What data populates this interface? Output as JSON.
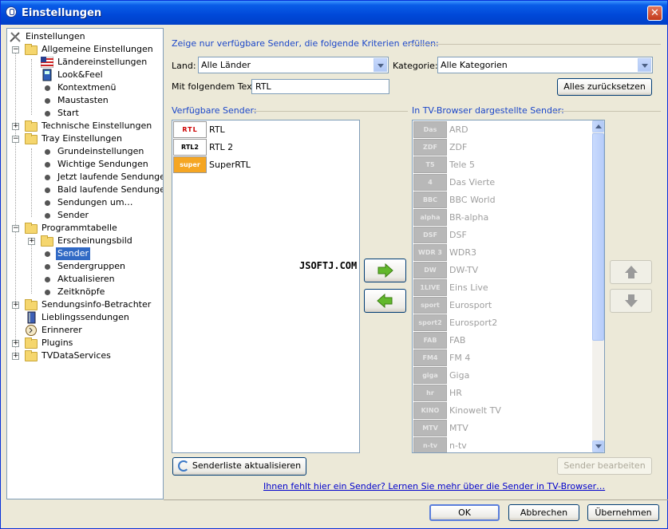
{
  "window": {
    "title": "Einstellungen"
  },
  "tree": [
    {
      "label": "Einstellungen"
    },
    {
      "label": "Allgemeine Einstellungen"
    },
    {
      "label": "Ländereinstellungen"
    },
    {
      "label": "Look&Feel"
    },
    {
      "label": "Kontextmenü"
    },
    {
      "label": "Maustasten"
    },
    {
      "label": "Start"
    },
    {
      "label": "Technische Einstellungen"
    },
    {
      "label": "Tray Einstellungen"
    },
    {
      "label": "Grundeinstellungen"
    },
    {
      "label": "Wichtige Sendungen"
    },
    {
      "label": "Jetzt laufende Sendungen"
    },
    {
      "label": "Bald laufende Sendungen"
    },
    {
      "label": "Sendungen um…"
    },
    {
      "label": "Sender"
    },
    {
      "label": "Programmtabelle"
    },
    {
      "label": "Erscheinungsbild"
    },
    {
      "label": "Sender",
      "selected": true
    },
    {
      "label": "Sendergruppen"
    },
    {
      "label": "Aktualisieren"
    },
    {
      "label": "Zeitknöpfe"
    },
    {
      "label": "Sendungsinfo-Betrachter"
    },
    {
      "label": "Lieblingssendungen"
    },
    {
      "label": "Erinnerer"
    },
    {
      "label": "Plugins"
    },
    {
      "label": "TVDataServices"
    }
  ],
  "filter": {
    "heading": "Zeige nur verfügbare Sender, die folgende Kriterien erfüllen:",
    "land_label": "Land:",
    "land_value": "Alle Länder",
    "kategorie_label": "Kategorie:",
    "kategorie_value": "Alle Kategorien",
    "text_label": "Mit folgendem Text:",
    "text_value": "RTL",
    "reset_button": "Alles zurücksetzen"
  },
  "available": {
    "heading": "Verfügbare Sender:",
    "channels": [
      {
        "name": "RTL",
        "logo": "RTL"
      },
      {
        "name": "RTL 2",
        "logo": "RTL2"
      },
      {
        "name": "SuperRTL",
        "logo": "super"
      }
    ]
  },
  "shown": {
    "heading": "In TV-Browser dargestellte Sender:",
    "channels": [
      {
        "name": "ARD",
        "logo": "Das Erste"
      },
      {
        "name": "ZDF",
        "logo": "ZDF"
      },
      {
        "name": "Tele 5",
        "logo": "T5"
      },
      {
        "name": "Das Vierte",
        "logo": "4"
      },
      {
        "name": "BBC World",
        "logo": "BBC"
      },
      {
        "name": "BR-alpha",
        "logo": "alpha"
      },
      {
        "name": "DSF",
        "logo": "DSF"
      },
      {
        "name": "WDR3",
        "logo": "WDR 3"
      },
      {
        "name": "DW-TV",
        "logo": "DW"
      },
      {
        "name": "Eins Live",
        "logo": "1LIVE"
      },
      {
        "name": "Eurosport",
        "logo": "sport"
      },
      {
        "name": "Eurosport2",
        "logo": "sport2"
      },
      {
        "name": "FAB",
        "logo": "FAB"
      },
      {
        "name": "FM 4",
        "logo": "FM4"
      },
      {
        "name": "Giga",
        "logo": "giga"
      },
      {
        "name": "HR",
        "logo": "hr"
      },
      {
        "name": "Kinowelt TV",
        "logo": "KINO"
      },
      {
        "name": "MTV",
        "logo": "MTV"
      },
      {
        "name": "n-tv",
        "logo": "n-tv"
      }
    ]
  },
  "watermark": "JSOFTJ.COM",
  "buttons": {
    "refresh_list": "Senderliste aktualisieren",
    "edit_channel": "Sender bearbeiten",
    "ok": "OK",
    "cancel": "Abbrechen",
    "apply": "Übernehmen"
  },
  "help_link": "Ihnen fehlt hier ein Sender? Lernen Sie mehr über die Sender in TV-Browser…",
  "colors": {
    "accent": "#1c47c9",
    "selection": "#316ac5",
    "titlebar": "#0a5de8"
  }
}
